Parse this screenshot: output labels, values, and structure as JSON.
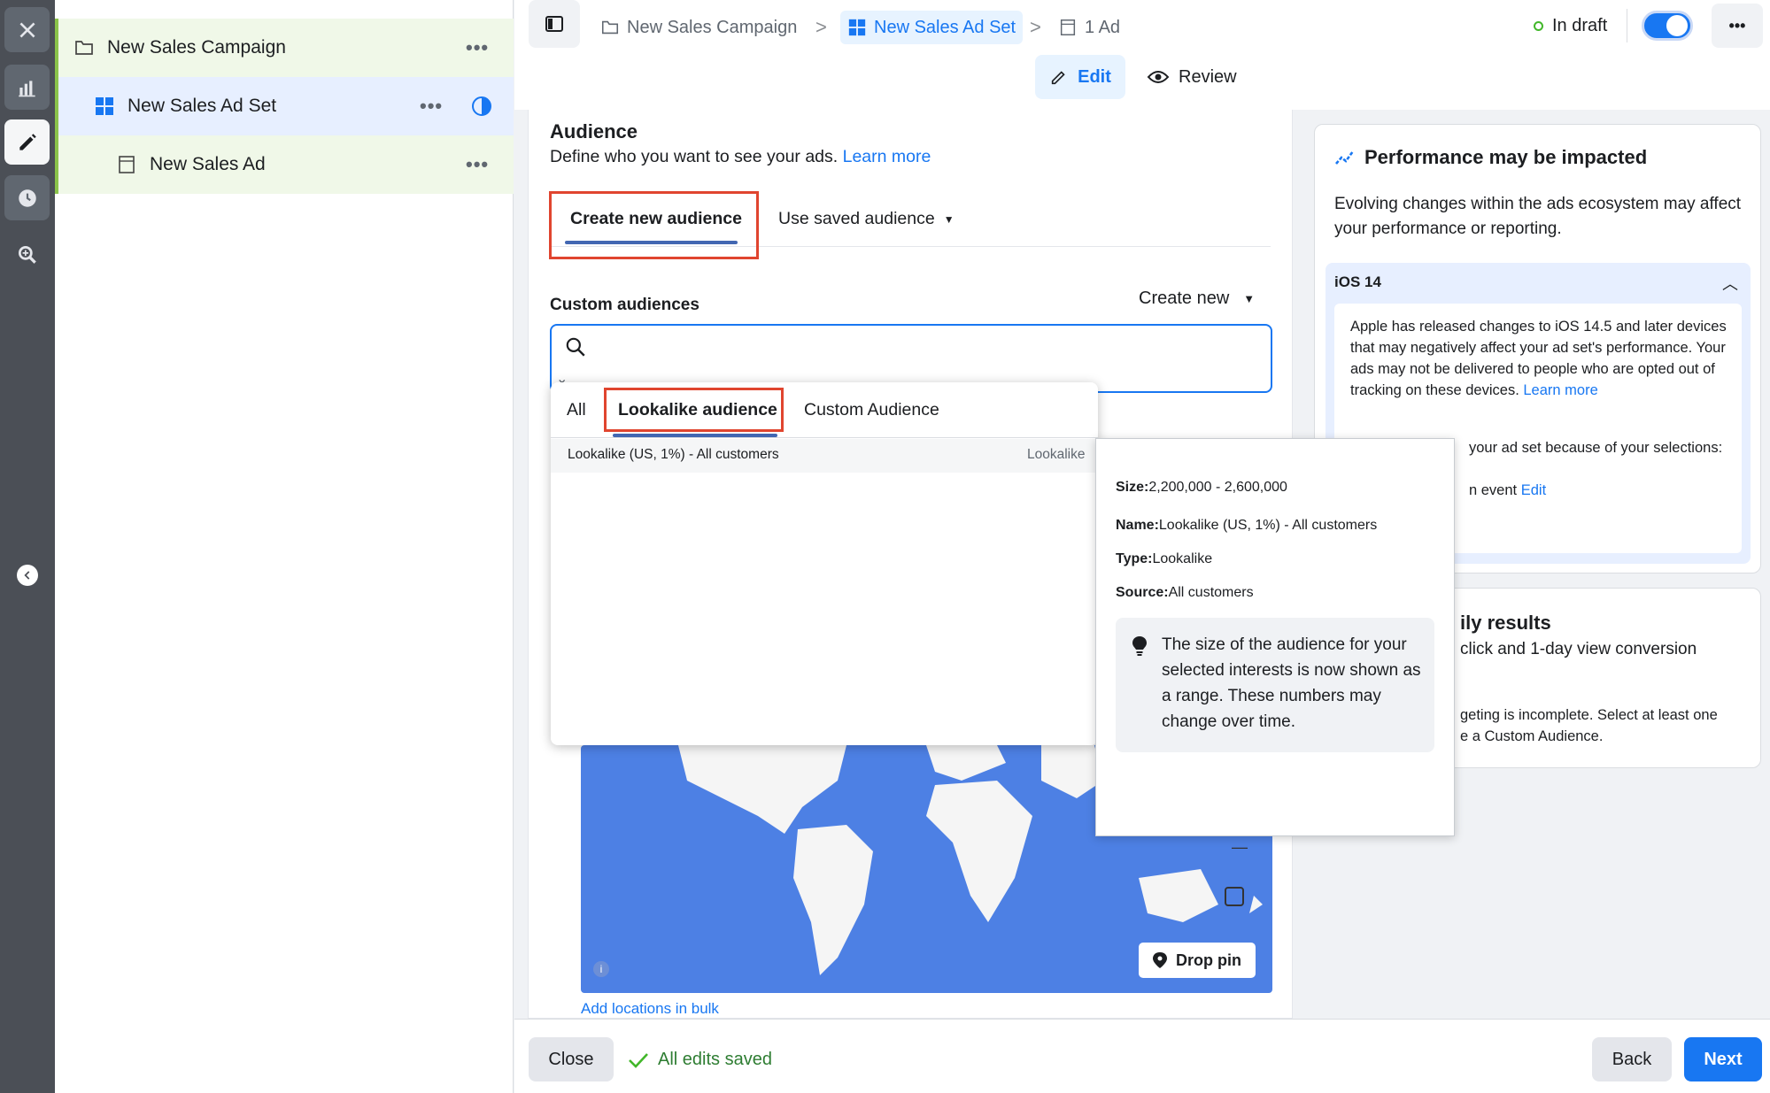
{
  "rail": {
    "icons": [
      "close-icon",
      "chart-icon",
      "pencil-icon",
      "clock-icon",
      "search-zoom-icon",
      "collapse-icon"
    ]
  },
  "tree": {
    "campaign": "New Sales Campaign",
    "adset": "New Sales Ad Set",
    "ad": "New Sales Ad",
    "dots": "•••"
  },
  "breadcrumb": {
    "campaign": "New Sales Campaign",
    "adset": "New Sales Ad Set",
    "ad": "1 Ad",
    "separator": ">"
  },
  "status": {
    "label": "In draft",
    "more": "•••"
  },
  "modes": {
    "edit": "Edit",
    "review": "Review"
  },
  "audience": {
    "title": "Audience",
    "description": "Define who you want to see your ads.",
    "learn_more": "Learn more",
    "tab_create": "Create new audience",
    "tab_saved": "Use saved audience",
    "custom_audiences_label": "Custom audiences",
    "create_new": "Create new",
    "search_placeholder": ""
  },
  "dropdown": {
    "tabs": [
      "All",
      "Lookalike audience",
      "Custom Audience"
    ],
    "items": [
      {
        "name": "Lookalike (US, 1%) - All customers",
        "type": "Lookalike"
      }
    ]
  },
  "tooltip": {
    "size_label": "Size:",
    "size_value": "2,200,000 - 2,600,000",
    "name_label": "Name:",
    "name_value": "Lookalike (US, 1%) - All customers",
    "type_label": "Type:",
    "type_value": "Lookalike",
    "source_label": "Source:",
    "source_value": "All customers",
    "note": "The size of the audience for your selected interests is now shown as a range. These numbers may change over time."
  },
  "map": {
    "drop_pin": "Drop pin",
    "add_bulk": "Add locations in bulk",
    "minus": "—"
  },
  "performance": {
    "title": "Performance may be impacted",
    "body": "Evolving changes within the ads ecosystem may affect your performance or reporting.",
    "ios_header": "iOS 14",
    "ios_body": "Apple has released changes to iOS 14.5 and later devices that may negatively affect your ad set's performance. Your ads may not be delivered to people who are opted out of tracking on these devices.",
    "ios_learn": "Learn more",
    "ios_partial1": "your ad set because of your selections:",
    "ios_partial2": "n event",
    "ios_edit": "Edit"
  },
  "daily": {
    "title_partial": "ily results",
    "line1_partial": "click and 1-day view conversion",
    "warn1_partial": "geting is incomplete. Select at least one",
    "warn2_partial": "e a Custom Audience."
  },
  "footer": {
    "close": "Close",
    "saved": "All edits saved",
    "back": "Back",
    "next": "Next"
  }
}
